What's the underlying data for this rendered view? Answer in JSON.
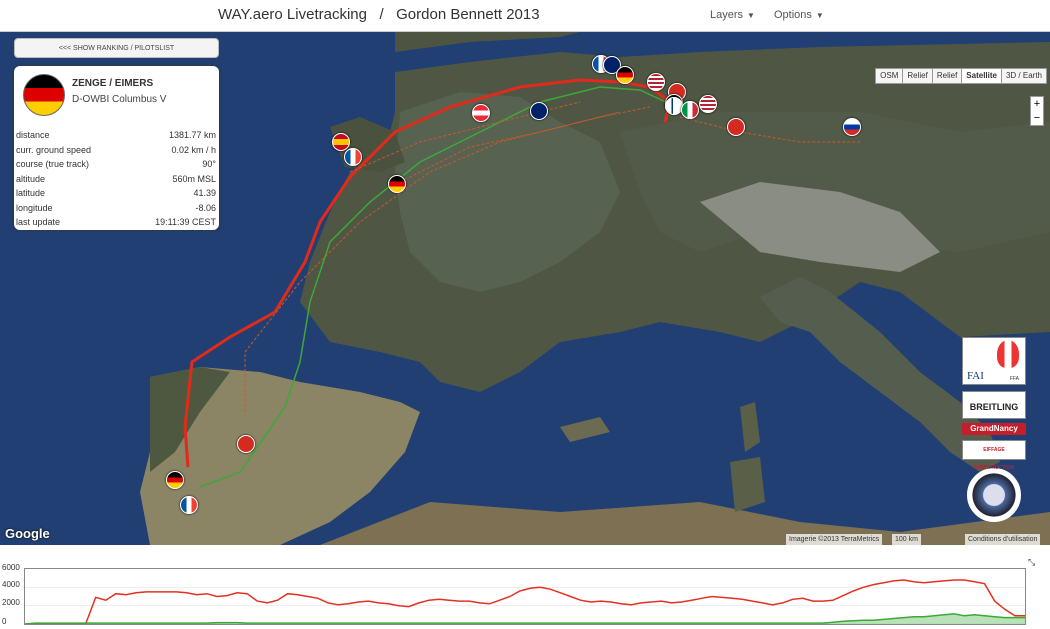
{
  "header": {
    "title": "WAY.aero Livetracking   /   Gordon Bennett 2013",
    "menu_layers": "Layers",
    "menu_options": "Options"
  },
  "map": {
    "ranking_button": "<<< SHOW RANKING / PILOTSLIST",
    "layer_buttons": [
      "OSM",
      "Relief",
      "Relief",
      "Satellite",
      "3D / Earth"
    ],
    "active_layer": "Satellite",
    "zoom_in": "+",
    "zoom_out": "−",
    "google_logo": "Google",
    "imagery": "Imagerie ©2013 TerraMetrics",
    "scale": "100 km",
    "terms": "Conditions d'utilisation"
  },
  "pilot": {
    "team": "ZENGE / EIMERS",
    "balloon": "D-OWBI Columbus V",
    "flag_colors": [
      "#000000",
      "#dd0000",
      "#ffce00"
    ],
    "rows": [
      {
        "label": "distance",
        "value": "1381.77 km"
      },
      {
        "label": "curr. ground speed",
        "value": "0.02 km / h"
      },
      {
        "label": "course (true track)",
        "value": "90°"
      },
      {
        "label": "altitude",
        "value": "560m MSL"
      },
      {
        "label": "latitude",
        "value": "41.39"
      },
      {
        "label": "longitude",
        "value": "-8.06"
      },
      {
        "label": "last update",
        "value": "19:11:39 CEST"
      }
    ]
  },
  "logos": {
    "fai": "FAI",
    "fai_sub": "FFA",
    "breitling": "BREITLING",
    "grandnancy": "GrandNancy",
    "eiffage": "EIFFAGE CONSTRUCTION"
  },
  "chart": {
    "yticks": [
      "6000",
      "4000",
      "2000",
      "0"
    ]
  },
  "chart_data": {
    "type": "line",
    "title": "",
    "xlabel": "",
    "ylabel": "",
    "ylim": [
      0,
      6000
    ],
    "series": [
      {
        "color": "#e53020",
        "values": [
          0,
          0,
          0,
          0,
          0,
          0,
          0,
          2900,
          2600,
          3300,
          3200,
          3400,
          3500,
          3500,
          3500,
          3500,
          3400,
          3200,
          3300,
          3000,
          3100,
          3400,
          3300,
          2500,
          2300,
          2600,
          3300,
          3200,
          3000,
          2800,
          2300,
          2100,
          2200,
          2400,
          2500,
          2300,
          2200,
          2000,
          1900,
          2300,
          2600,
          2700,
          2600,
          2500,
          2500,
          2300,
          2200,
          2600,
          3000,
          3600,
          3900,
          4000,
          3800,
          3400,
          3000,
          2600,
          2400,
          2500,
          2400,
          2200,
          2100,
          2300,
          2400,
          2500,
          2300,
          2400,
          2600,
          2800,
          3000,
          2900,
          2800,
          2700,
          2500,
          2300,
          2100,
          2300,
          2700,
          2800,
          2500,
          2500,
          2600,
          3100,
          3600,
          4000,
          4300,
          4500,
          4700,
          4800,
          4600,
          4500,
          4600,
          4700,
          4800,
          4800,
          4600,
          4400,
          2500,
          1600,
          900,
          900
        ]
      },
      {
        "color": "#3aaa35",
        "values": [
          0,
          100,
          100,
          100,
          100,
          100,
          100,
          100,
          100,
          100,
          100,
          100,
          100,
          100,
          100,
          100,
          100,
          100,
          100,
          150,
          150,
          150,
          100,
          100,
          100,
          100,
          100,
          100,
          100,
          100,
          100,
          100,
          100,
          100,
          100,
          100,
          100,
          100,
          100,
          100,
          100,
          100,
          100,
          100,
          100,
          100,
          100,
          100,
          100,
          100,
          100,
          100,
          100,
          100,
          100,
          100,
          100,
          100,
          100,
          100,
          100,
          100,
          100,
          100,
          100,
          100,
          100,
          100,
          100,
          100,
          100,
          100,
          100,
          100,
          100,
          100,
          100,
          100,
          100,
          100,
          200,
          300,
          350,
          400,
          400,
          500,
          600,
          700,
          800,
          800,
          900,
          1000,
          1100,
          900,
          1000,
          900,
          800,
          700,
          700,
          700
        ]
      }
    ]
  }
}
